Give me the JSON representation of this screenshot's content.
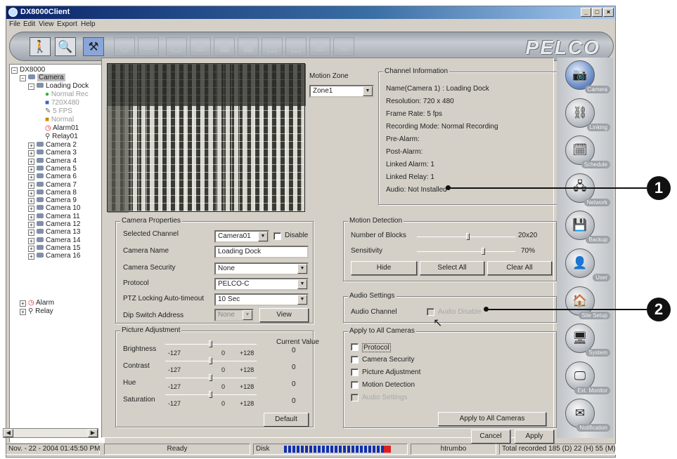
{
  "window": {
    "title": "DX8000Client"
  },
  "menu": [
    "File",
    "Edit",
    "View",
    "Export",
    "Help"
  ],
  "toolbar": {
    "buttons": [
      {
        "icon": "person-icon"
      },
      {
        "icon": "search-camera-icon"
      },
      {
        "icon": "tools-icon"
      },
      {
        "icon": "clock-icon"
      },
      {
        "icon": "export-icon"
      },
      {
        "icon": "layout-1-icon"
      },
      {
        "icon": "layout-4-icon"
      },
      {
        "icon": "layout-9-icon"
      },
      {
        "icon": "layout-16-icon"
      },
      {
        "icon": "layout-6-icon"
      },
      {
        "icon": "layout-8-icon"
      },
      {
        "icon": "layout-10-icon"
      },
      {
        "icon": "layout-custom-icon"
      }
    ],
    "logo": "PELCO"
  },
  "tree": {
    "root": "DX8000",
    "camera_group": "Camera",
    "selected_camera": "Loading Dock",
    "selected_children": [
      "Normal Rec",
      "720X480",
      "5 FPS",
      "Normal",
      "Alarm01",
      "Relay01"
    ],
    "cameras": [
      "Camera 2",
      "Camera 3",
      "Camera 4",
      "Camera 5",
      "Camera 6",
      "Camera 7",
      "Camera 8",
      "Camera 9",
      "Camera 10",
      "Camera 11",
      "Camera 12",
      "Camera 13",
      "Camera 14",
      "Camera 15",
      "Camera 16"
    ],
    "alarm": "Alarm",
    "relay": "Relay"
  },
  "motion_zone": {
    "label": "Motion Zone",
    "value": "Zone1"
  },
  "channel_info": {
    "title": "Channel Information",
    "lines": [
      "Name(Camera  1) : Loading Dock",
      "Resolution: 720 x 480",
      "Frame Rate:  5 fps",
      "Recording Mode: Normal Recording",
      "Pre-Alarm:",
      "Post-Alarm:",
      "Linked Alarm: 1",
      "Linked Relay: 1",
      "Audio: Not Installed"
    ]
  },
  "camera_properties": {
    "title": "Camera Properties",
    "selected_channel_label": "Selected Channel",
    "selected_channel": "Camera01",
    "disable_label": "Disable",
    "camera_name_label": "Camera Name",
    "camera_name": "Loading Dock",
    "security_label": "Camera Security",
    "security": "None",
    "protocol_label": "Protocol",
    "protocol": "PELCO-C",
    "ptz_label": "PTZ Locking Auto-timeout",
    "ptz": "10 Sec",
    "dip_label": "Dip Switch Address",
    "dip": "None",
    "view_button": "View"
  },
  "picture_adjustment": {
    "title": "Picture Adjustment",
    "current_value_label": "Current Value",
    "rows": [
      {
        "label": "Brightness",
        "value": "0",
        "min": "-127",
        "mid": "0",
        "max": "+128"
      },
      {
        "label": "Contrast",
        "value": "0",
        "min": "-127",
        "mid": "0",
        "max": "+128"
      },
      {
        "label": "Hue",
        "value": "0",
        "min": "-127",
        "mid": "0",
        "max": "+128"
      },
      {
        "label": "Saturation",
        "value": "0",
        "min": "-127",
        "mid": "0",
        "max": "+128"
      }
    ],
    "default_button": "Default"
  },
  "motion_detection": {
    "title": "Motion Detection",
    "blocks_label": "Number of Blocks",
    "blocks_value": "20x20",
    "sensitivity_label": "Sensitivity",
    "sensitivity_value": "70%",
    "hide_button": "Hide",
    "select_all_button": "Select All",
    "clear_all_button": "Clear All"
  },
  "audio_settings": {
    "title": "Audio Settings",
    "channel_label": "Audio Channel",
    "disable_label": "Audio Disable"
  },
  "apply_all": {
    "title": "Apply to All Cameras",
    "options": [
      "Protocol",
      "Camera Security",
      "Picture Adjustment",
      "Motion Detection",
      "Audio Settings"
    ],
    "apply_button": "Apply to All Cameras"
  },
  "dialog_buttons": {
    "cancel": "Cancel",
    "apply": "Apply"
  },
  "side_nav": [
    "Camera",
    "Linking",
    "Schedule",
    "Network",
    "Backup",
    "User",
    "Site Setup",
    "System",
    "Ext. Monitor",
    "Notification"
  ],
  "status": {
    "datetime": "Nov. - 22 - 2004  01:45:50 PM",
    "state": "Ready",
    "disk_label": "Disk",
    "user": "htrumbo",
    "recorded": "Total recorded 185 (D) 22 (H) 55 (M)"
  },
  "callouts": [
    "1",
    "2"
  ]
}
